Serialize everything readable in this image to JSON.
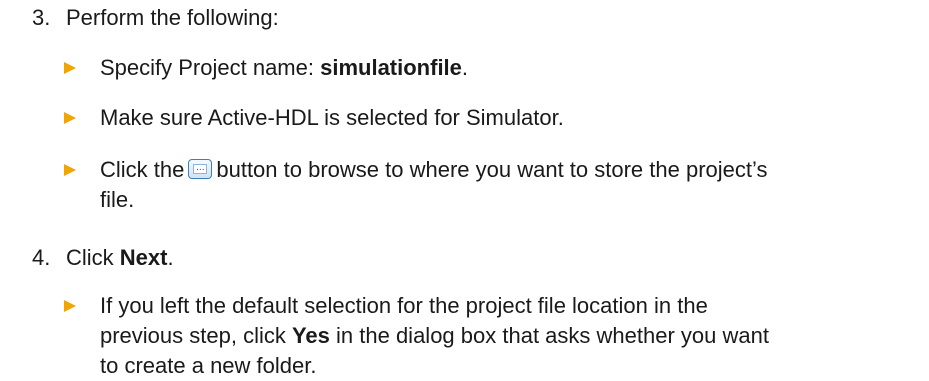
{
  "steps": [
    {
      "number": "3.",
      "text": "Perform the following:",
      "bullets": [
        {
          "prefix": "Specify Project name: ",
          "bold": "simulationfile",
          "suffix": "."
        },
        {
          "text": "Make sure Active-HDL is selected for Simulator."
        },
        {
          "prefix": "Click the",
          "button_icon": "browse-ellipsis-icon",
          "button_glyph": "...",
          "line1_suffix": "button to browse to where you want to store the project’s",
          "line2": "file."
        }
      ]
    },
    {
      "number": "4.",
      "prefix": "Click ",
      "bold": "Next",
      "suffix": ".",
      "bullets": [
        {
          "line1": "If you left the default selection for the project file location in the",
          "line2_prefix": "previous step, click ",
          "line2_bold": "Yes",
          "line2_suffix": " in the dialog box that asks whether you want",
          "line3": "to create a new folder."
        }
      ]
    }
  ],
  "colors": {
    "bullet_arrow": "#f2a500",
    "text": "#1a1a1a",
    "button_border": "#3f7fb8"
  }
}
